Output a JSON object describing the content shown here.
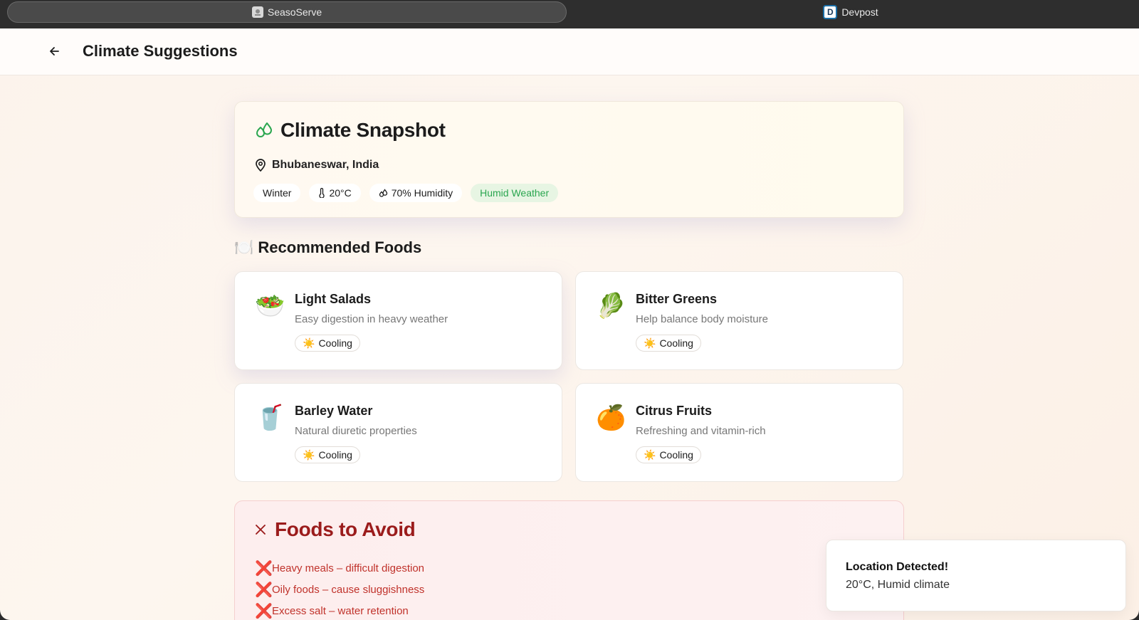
{
  "browser": {
    "tabs": [
      {
        "label": "SeasoServe",
        "active": true,
        "icon": "seasoserve-favicon"
      },
      {
        "label": "Devpost",
        "active": false,
        "icon": "devpost-favicon",
        "icon_letter": "D"
      }
    ]
  },
  "header": {
    "back_icon": "arrow-left-icon",
    "title": "Climate Suggestions"
  },
  "snapshot": {
    "icon": "droplets-icon",
    "title": "Climate Snapshot",
    "location_icon": "map-pin-icon",
    "location": "Bhubaneswar, India",
    "chips": {
      "season": "Winter",
      "temperature": "20°C",
      "humidity": "70% Humidity",
      "weather": "Humid Weather"
    }
  },
  "recommended": {
    "emoji": "🍽️",
    "heading": "Recommended Foods",
    "items": [
      {
        "emoji": "🥗",
        "name": "Light Salads",
        "description": "Easy digestion in heavy weather",
        "tag_emoji": "☀️",
        "tag": "Cooling"
      },
      {
        "emoji": "🥬",
        "name": "Bitter Greens",
        "description": "Help balance body moisture",
        "tag_emoji": "☀️",
        "tag": "Cooling"
      },
      {
        "emoji": "🥤",
        "name": "Barley Water",
        "description": "Natural diuretic properties",
        "tag_emoji": "☀️",
        "tag": "Cooling"
      },
      {
        "emoji": "🍊",
        "name": "Citrus Fruits",
        "description": "Refreshing and vitamin-rich",
        "tag_emoji": "☀️",
        "tag": "Cooling"
      }
    ]
  },
  "avoid": {
    "icon": "close-icon",
    "heading": "Foods to Avoid",
    "mark": "❌",
    "items": [
      "Heavy meals – difficult digestion",
      "Oily foods – cause sluggishness",
      "Excess salt – water retention"
    ]
  },
  "toast": {
    "title": "Location Detected!",
    "message": "20°C, Humid climate"
  },
  "colors": {
    "accent_green": "#2aa64f",
    "avoid_red": "#9b1c1c",
    "avoid_text": "#c0322b",
    "page_bg": "#fcf3ec"
  }
}
